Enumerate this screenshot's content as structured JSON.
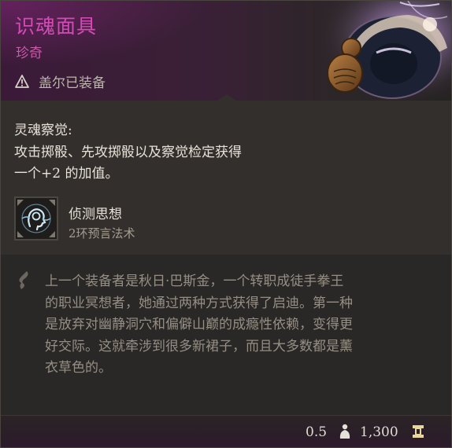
{
  "item": {
    "name": "识魂面具",
    "rarity": "珍奇",
    "equipped_status": "盖尔已装备"
  },
  "passive": {
    "title": "灵魂察觉:",
    "description": "攻击掷骰、先攻掷骰以及察觉检定获得\n一个+2 的加值。"
  },
  "spell": {
    "name": "侦测思想",
    "subtitle": "2环预言法术",
    "icon": "mind-head-icon"
  },
  "lore": {
    "icon": "feather-icon",
    "text": "上一个装备者是秋日·巴斯金，一个转职成徒手拳王\n的职业冥想者，她通过两种方式获得了启迪。第一种\n是放弃对幽静洞穴和偏僻山巅的成瘾性依赖，变得更\n好交际。这就牵涉到很多新裙子，而且大多数都是薰\n衣草色的。"
  },
  "footer": {
    "weight": "0.5",
    "weight_icon": "weight-icon",
    "price": "1,300",
    "price_icon": "gold-coin-icon"
  },
  "colors": {
    "rarity_accent": "#d44ab6",
    "body_text": "#e8e2d8",
    "lore_text": "#958e84"
  }
}
